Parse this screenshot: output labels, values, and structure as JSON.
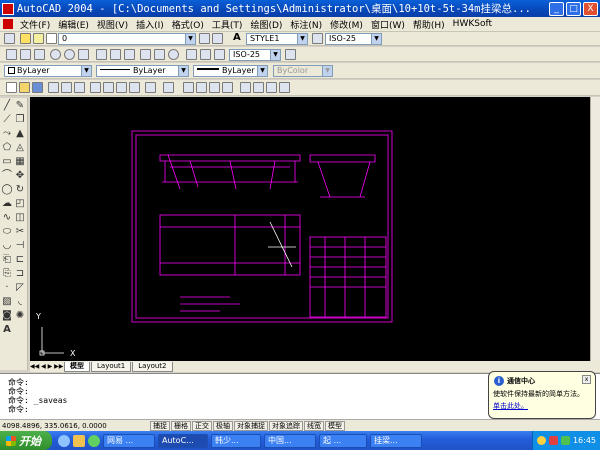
{
  "window": {
    "title": "AutoCAD 2004 - [C:\\Documents and Settings\\Administrator\\桌面\\10+10t-5t-34m挂梁总...",
    "min": "_",
    "max": "□",
    "close": "X"
  },
  "menu": [
    "文件(F)",
    "编辑(E)",
    "视图(V)",
    "插入(I)",
    "格式(O)",
    "工具(T)",
    "绘图(D)",
    "标注(N)",
    "修改(M)",
    "窗口(W)",
    "帮助(H)",
    "HWKSoft"
  ],
  "toolbar": {
    "layer_value": "0",
    "text_style": "STYLE1",
    "dim_style": "ISO-25",
    "dim_style2": "ISO-25",
    "color": "ByLayer",
    "linetype": "ByLayer",
    "lineweight": "ByLayer",
    "plotstyle": "ByColor"
  },
  "ucs": {
    "y": "Y",
    "x": "X"
  },
  "tabs": [
    "模型",
    "Layout1",
    "Layout2"
  ],
  "command": {
    "lines": [
      "命令:",
      "命令:",
      "命令:  _saveas",
      "命令:"
    ]
  },
  "status": {
    "coords": "4098.4896, 335.0616, 0.0000",
    "buttons": [
      "捕捉",
      "栅格",
      "正交",
      "极轴",
      "对象捕捉",
      "对象追踪",
      "线宽",
      "模型"
    ]
  },
  "balloon": {
    "title": "通信中心",
    "body": "使软件保持最新的简单方法。",
    "link": "单击此处。",
    "close": "x"
  },
  "taskbar": {
    "start": "开始",
    "tasks": [
      "网易 ...",
      "AutoC...",
      "韩少...",
      "中国...",
      "起 ...",
      "挂梁..."
    ],
    "clock": "16:45"
  },
  "colors": {
    "drawing": "#ff00ff",
    "canvas": "#000000",
    "taskbar": "#245edb"
  }
}
